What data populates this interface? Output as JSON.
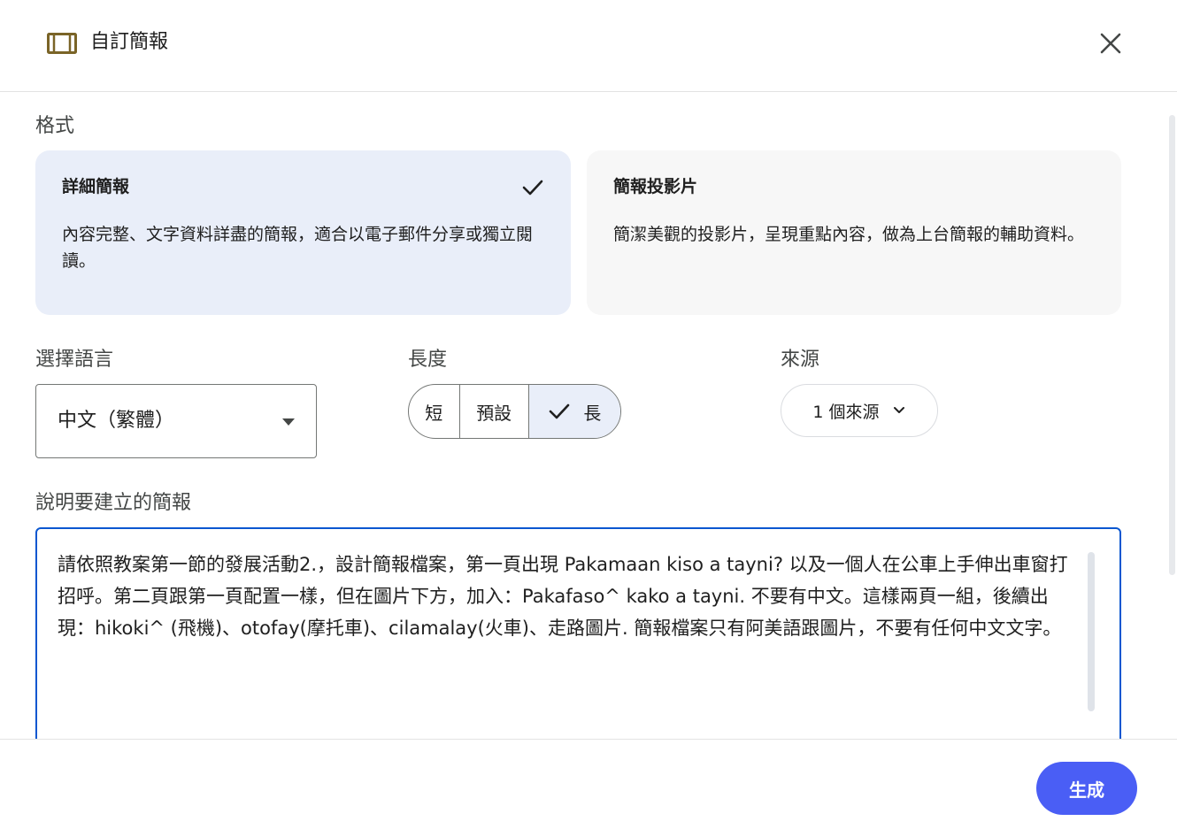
{
  "header": {
    "title": "自訂簡報",
    "icon": "slideshow-icon",
    "close_icon": "close-icon"
  },
  "format": {
    "label": "格式",
    "cards": [
      {
        "title": "詳細簡報",
        "description": "內容完整、文字資料詳盡的簡報，適合以電子郵件分享或獨立閱讀。",
        "selected": true
      },
      {
        "title": "簡報投影片",
        "description": "簡潔美觀的投影片，呈現重點內容，做為上台簡報的輔助資料。",
        "selected": false
      }
    ]
  },
  "language": {
    "label": "選擇語言",
    "value": "中文（繁體）"
  },
  "length": {
    "label": "長度",
    "options": [
      {
        "label": "短",
        "selected": false
      },
      {
        "label": "預設",
        "selected": false
      },
      {
        "label": "長",
        "selected": true
      }
    ]
  },
  "sources": {
    "label": "來源",
    "value": "1 個來源"
  },
  "prompt": {
    "label": "說明要建立的簡報",
    "value": "請依照教案第一節的發展活動2.，設計簡報檔案，第一頁出現 Pakamaan kiso a tayni? 以及一個人在公車上手伸出車窗打招呼。第二頁跟第一頁配置一樣，但在圖片下方，加入：Pakafaso^ kako a tayni. 不要有中文。這樣兩頁一組，後續出現：hikoki^ (飛機)、otofay(摩托車)、cilamalay(火車)、走路圖片. 簡報檔案只有阿美語跟圖片，不要有任何中文文字。"
  },
  "footer": {
    "generate_label": "生成"
  },
  "colors": {
    "accent": "#0b57d0",
    "selected_bg": "#e9eef9",
    "card_bg": "#f7f7f7",
    "generate_bg": "#4a5ef5",
    "icon_brown": "#7a6427"
  }
}
